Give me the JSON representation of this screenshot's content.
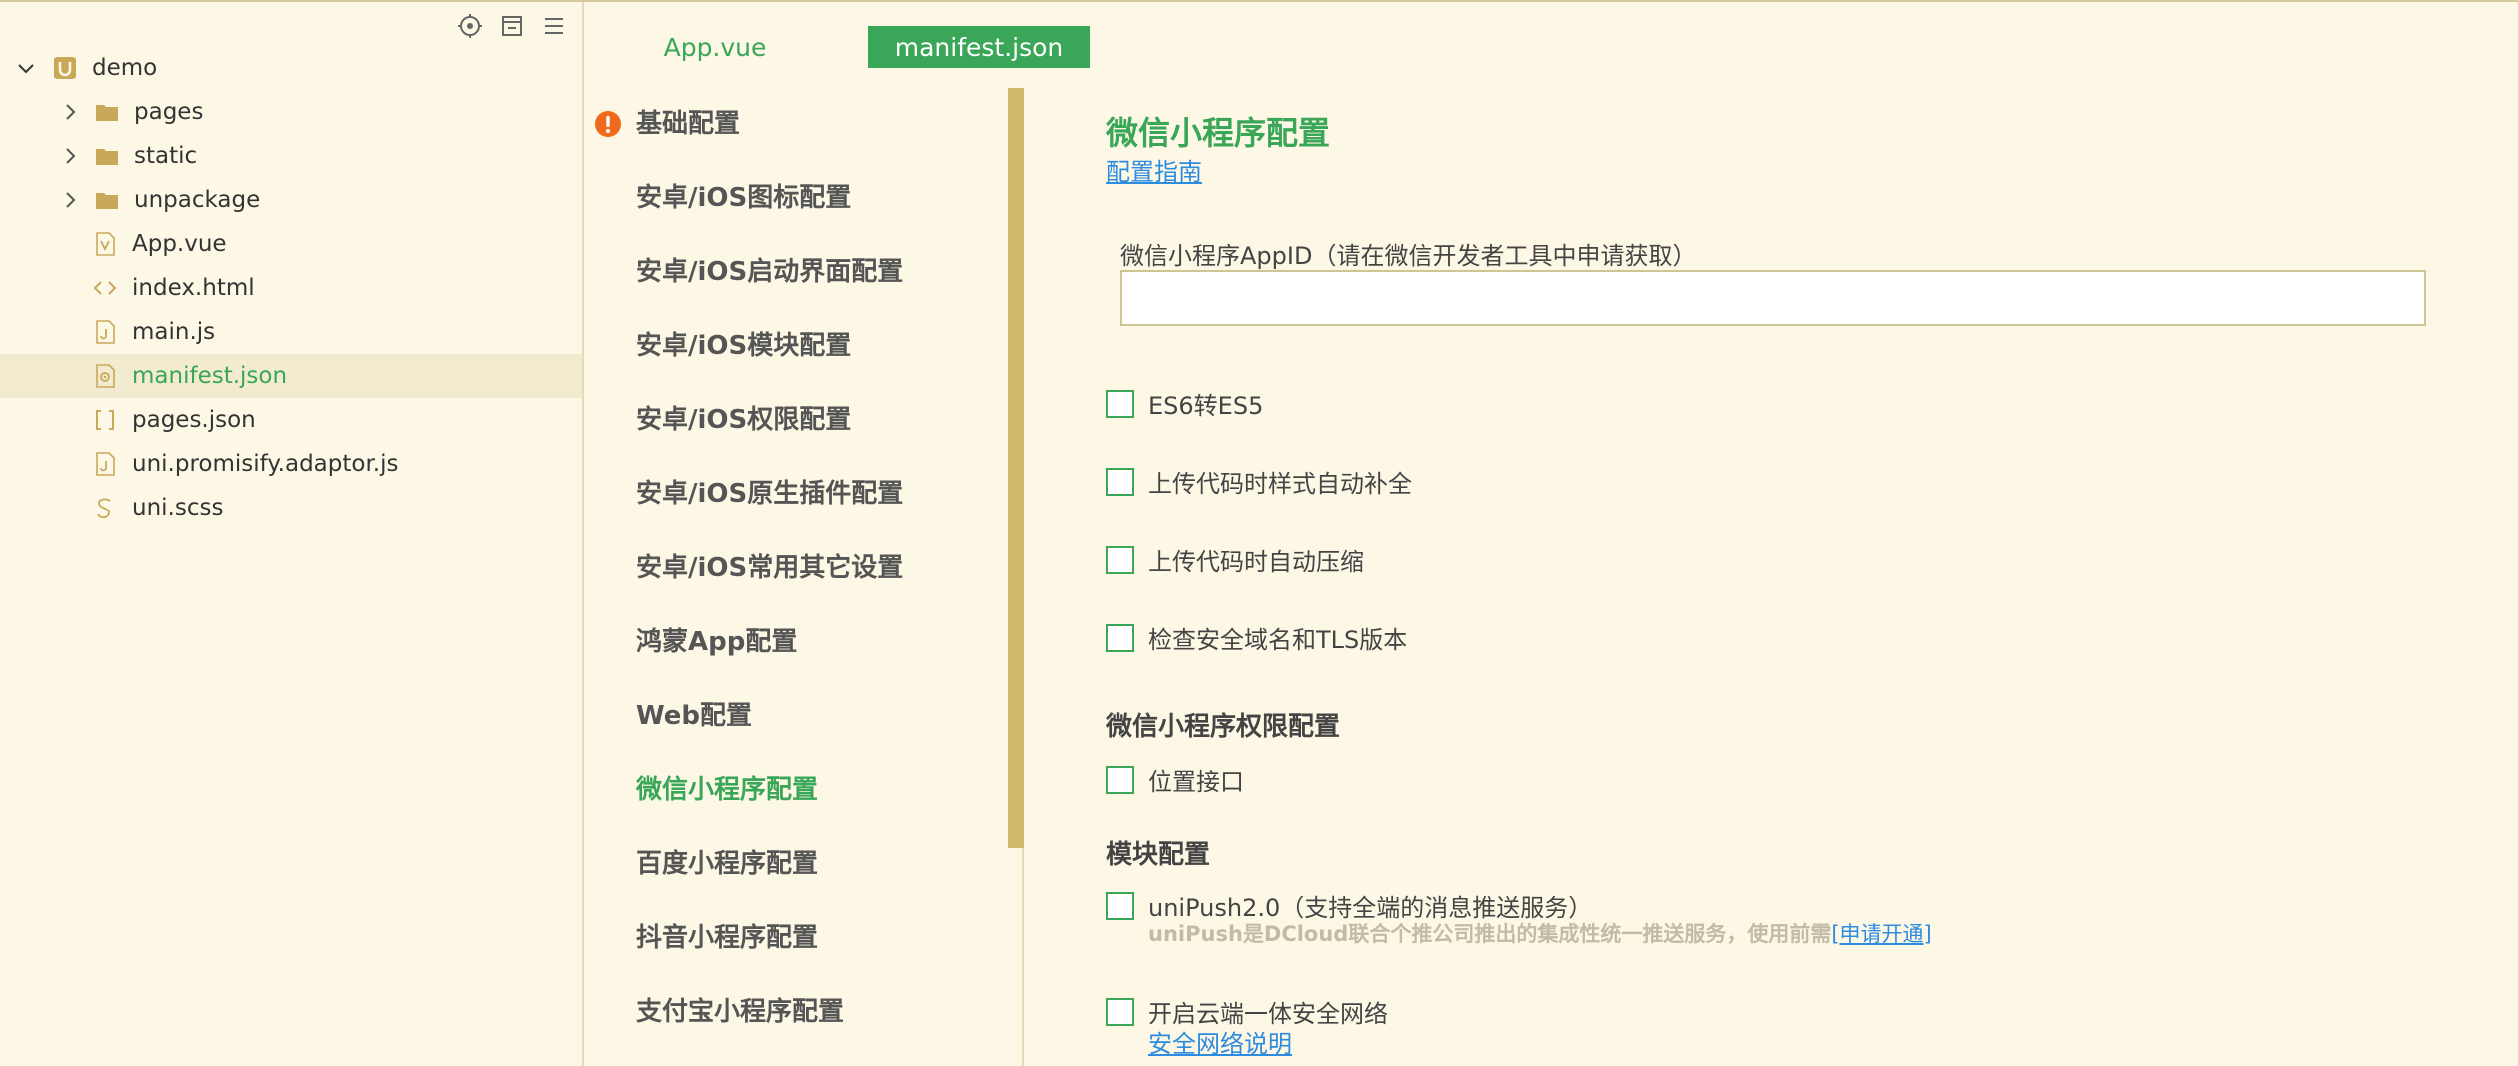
{
  "explorer": {
    "toolbar_icons": [
      "target-icon",
      "collapse-icon",
      "menu-icon"
    ],
    "items": [
      {
        "label": "demo",
        "icon": "project-icon",
        "expanded": true,
        "indent": 0
      },
      {
        "label": "pages",
        "icon": "folder-icon",
        "expanded": false,
        "indent": 1
      },
      {
        "label": "static",
        "icon": "folder-icon",
        "expanded": false,
        "indent": 1
      },
      {
        "label": "unpackage",
        "icon": "folder-icon",
        "expanded": false,
        "indent": 1
      },
      {
        "label": "App.vue",
        "icon": "vue-file-icon",
        "indent": 1
      },
      {
        "label": "index.html",
        "icon": "html-file-icon",
        "indent": 1
      },
      {
        "label": "main.js",
        "icon": "js-file-icon",
        "indent": 1
      },
      {
        "label": "manifest.json",
        "icon": "settings-file-icon",
        "indent": 1,
        "selected": true
      },
      {
        "label": "pages.json",
        "icon": "json-file-icon",
        "indent": 1
      },
      {
        "label": "uni.promisify.adaptor.js",
        "icon": "js-file-icon",
        "indent": 1
      },
      {
        "label": "uni.scss",
        "icon": "scss-file-icon",
        "indent": 1
      }
    ]
  },
  "tabs": [
    {
      "label": "App.vue",
      "active": false
    },
    {
      "label": "manifest.json",
      "active": true
    }
  ],
  "nav": {
    "items": [
      {
        "label": "基础配置",
        "warning": true
      },
      {
        "label": "安卓/iOS图标配置"
      },
      {
        "label": "安卓/iOS启动界面配置"
      },
      {
        "label": "安卓/iOS模块配置"
      },
      {
        "label": "安卓/iOS权限配置"
      },
      {
        "label": "安卓/iOS原生插件配置"
      },
      {
        "label": "安卓/iOS常用其它设置"
      },
      {
        "label": "鸿蒙App配置"
      },
      {
        "label": "Web配置"
      },
      {
        "label": "微信小程序配置",
        "active": true
      },
      {
        "label": "百度小程序配置"
      },
      {
        "label": "抖音小程序配置"
      },
      {
        "label": "支付宝小程序配置"
      }
    ]
  },
  "content": {
    "title": "微信小程序配置",
    "guide_link": "配置指南",
    "appid_label": "微信小程序AppID（请在微信开发者工具中申请获取）",
    "appid_value": "",
    "checkboxes": [
      {
        "label": "ES6转ES5",
        "checked": false
      },
      {
        "label": "上传代码时样式自动补全",
        "checked": false
      },
      {
        "label": "上传代码时自动压缩",
        "checked": false
      },
      {
        "label": "检查安全域名和TLS版本",
        "checked": false
      }
    ],
    "permissions_heading": "微信小程序权限配置",
    "location_label": "位置接口",
    "modules_heading": "模块配置",
    "unipush_label": "uniPush2.0（支持全端的消息推送服务）",
    "unipush_desc": "uniPush是DCloud联合个推公司推出的集成性统一推送服务，使用前需",
    "unipush_link": "[申请开通]",
    "secure_net_label": "开启云端一体安全网络",
    "secure_net_link": "安全网络说明"
  },
  "colors": {
    "accent": "#3aa657",
    "background": "#fdf8e6",
    "link": "#2d8be0",
    "warning": "#f06a1d",
    "folder": "#c9a85a"
  }
}
